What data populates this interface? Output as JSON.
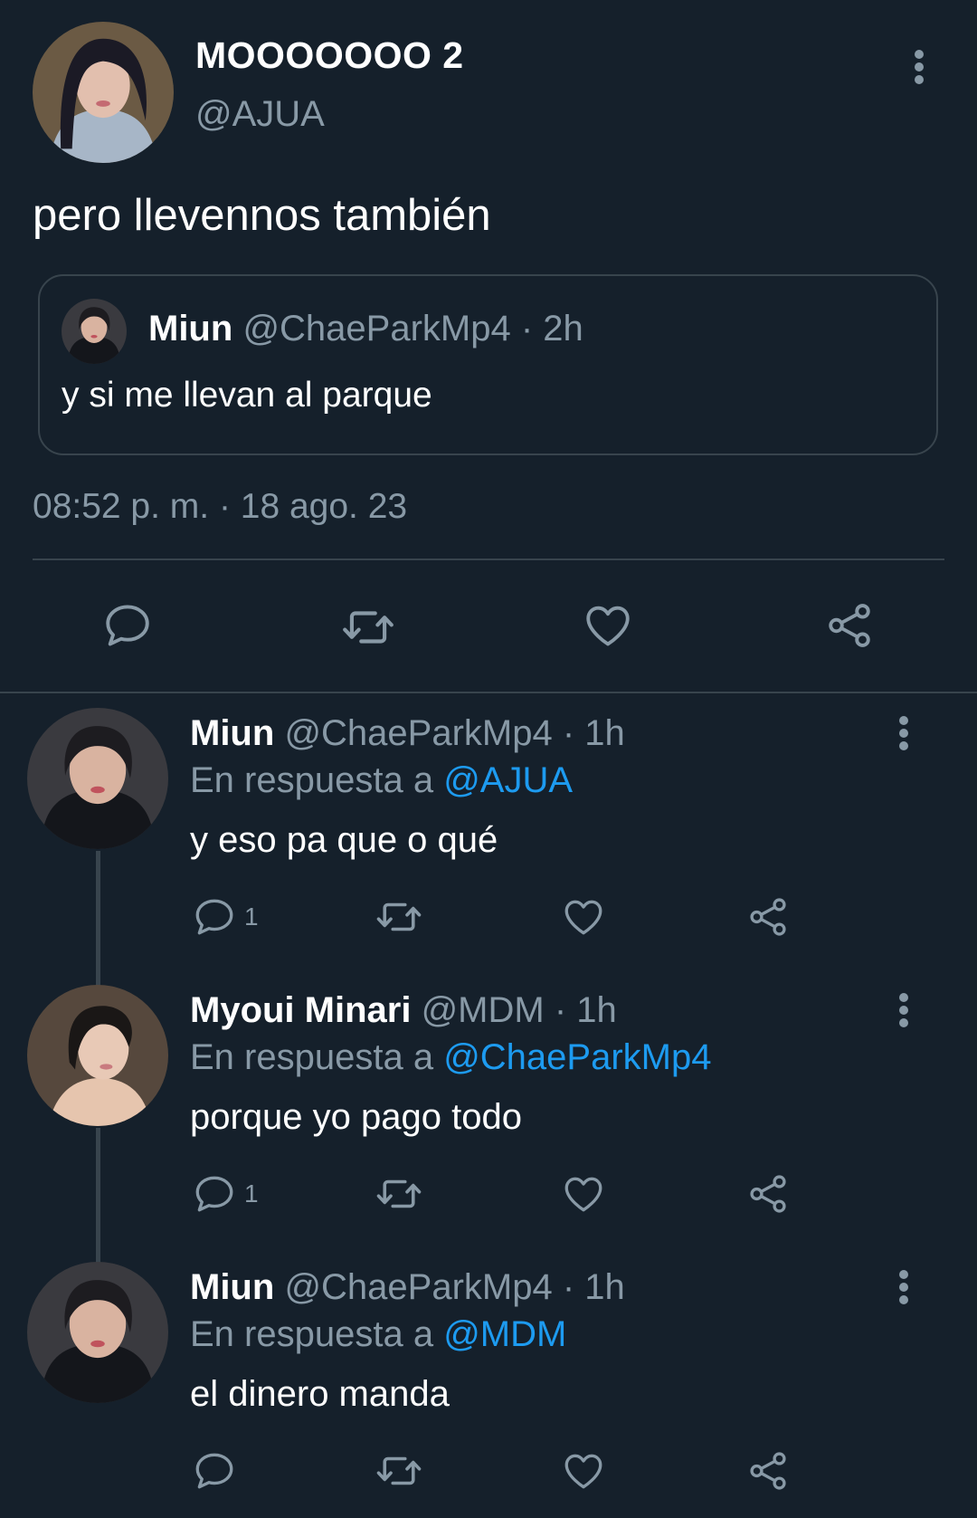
{
  "main": {
    "display_name": "MOOOOOOO 2",
    "handle": "@AJUA",
    "text": "pero llevennos también",
    "timestamp": "08:52 p. m. · 18 ago. 23",
    "quote": {
      "name": "Miun",
      "handle": "@ChaeParkMp4",
      "time": "· 2h",
      "text": "y si me llevan al parque"
    },
    "actions": [
      "reply-icon",
      "retweet-icon",
      "like-icon",
      "share-icon"
    ]
  },
  "replies": [
    {
      "name": "Miun",
      "handle": "@ChaeParkMp4",
      "time": "· 1h",
      "reply_prefix": "En respuesta a",
      "reply_to": "@AJUA",
      "text": "y eso pa que o qué",
      "reply_count": "1"
    },
    {
      "name": "Myoui Minari",
      "handle": "@MDM",
      "time": "· 1h",
      "reply_prefix": "En respuesta a",
      "reply_to": "@ChaeParkMp4",
      "text": "porque yo pago todo",
      "reply_count": "1"
    },
    {
      "name": "Miun",
      "handle": "@ChaeParkMp4",
      "time": "· 1h",
      "reply_prefix": "En respuesta a",
      "reply_to": "@MDM",
      "text": "el dinero manda",
      "reply_count": ""
    }
  ],
  "colors": {
    "background": "#15202b",
    "muted": "#8899a6",
    "link": "#1d9bf0",
    "border": "#38444d"
  }
}
